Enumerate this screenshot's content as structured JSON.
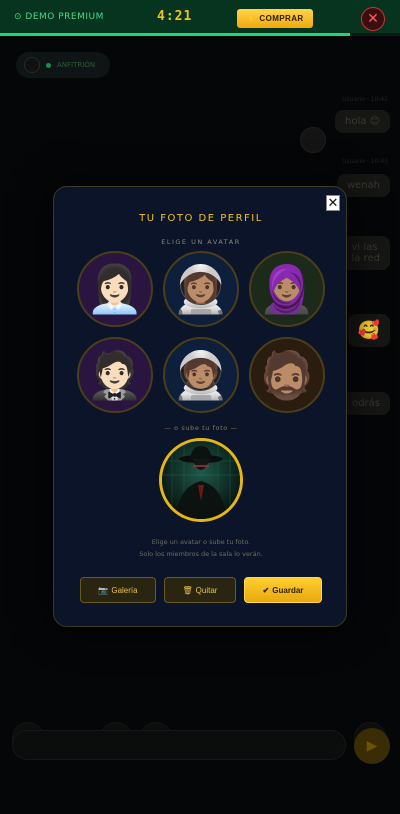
{
  "topbar": {
    "demo_label": "⊙ DEMO PREMIUM",
    "timer": "4:21",
    "buy_label": "⚡ COMPRAR",
    "close_symbol": "✕",
    "progress_fraction": 0.875,
    "accent_color": "#1ed67a",
    "timer_color": "#f0c31d"
  },
  "chat_background": {
    "status_text": "ANFITRIÓN",
    "messages": [
      {
        "text": "hola 😊",
        "meta": "Usuario · 10:42"
      },
      {
        "text": "wenah",
        "meta": "Usuario · 10:43"
      },
      {
        "text": "vi las\nla red",
        "meta": ""
      },
      {
        "text": "🥰",
        "meta": ""
      },
      {
        "text": "odrás",
        "meta": ""
      }
    ],
    "tools": [
      "🌐",
      "🎁",
      "📡",
      "😊"
    ],
    "send_symbol": "▶"
  },
  "modal": {
    "close_symbol": "✕",
    "title": "TU FOTO DE PERFIL",
    "subtitle": "ELIGE UN AVATAR",
    "avatars": [
      {
        "emoji": "👩🏻‍💼",
        "icon_name": "woman-office-worker-icon"
      },
      {
        "emoji": "👩🏽‍🚀",
        "icon_name": "woman-astronaut-icon"
      },
      {
        "emoji": "🧕🏽",
        "icon_name": "woman-headscarf-icon"
      },
      {
        "emoji": "🤵🏻",
        "icon_name": "man-tuxedo-icon"
      },
      {
        "emoji": "🧑🏽‍🚀",
        "icon_name": "astronaut-icon"
      },
      {
        "emoji": "🧔🏽",
        "icon_name": "bearded-man-icon"
      }
    ],
    "or_upload": "— o sube tu foto —",
    "hint_line1": "Elige un avatar o sube tu foto.",
    "hint_line2": "Solo los miembros de la sala lo verán.",
    "buttons": {
      "gallery": {
        "icon": "📷",
        "label": "Galería"
      },
      "remove": {
        "icon": "🗑",
        "label": "Quitar"
      },
      "save": {
        "icon": "✔",
        "label": "Guardar"
      }
    },
    "accent_color": "#f0c31d"
  }
}
